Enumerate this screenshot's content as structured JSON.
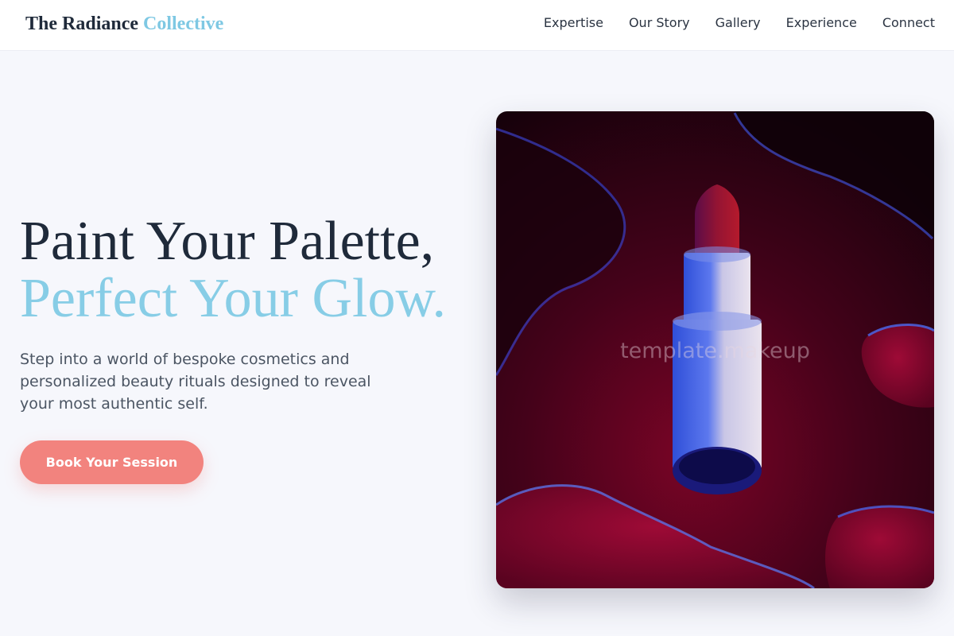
{
  "header": {
    "brand": {
      "primary": "The Radiance",
      "accent": "Collective"
    },
    "nav": [
      {
        "label": "Expertise"
      },
      {
        "label": "Our Story"
      },
      {
        "label": "Gallery"
      },
      {
        "label": "Experience"
      },
      {
        "label": "Connect"
      }
    ]
  },
  "hero": {
    "title_line1": "Paint Your Palette,",
    "title_line2": "Perfect Your Glow.",
    "subtitle": "Step into a world of bespoke cosmetics and personalized beauty rituals designed to reveal your most authentic self.",
    "cta_label": "Book Your Session",
    "image": {
      "subject": "lipstick",
      "watermark": "template.makeup"
    }
  },
  "colors": {
    "primary_text": "#1f2a3a",
    "accent_blue": "#87cde6",
    "cta_coral": "#f2837e",
    "background": "#f6f7fc"
  }
}
